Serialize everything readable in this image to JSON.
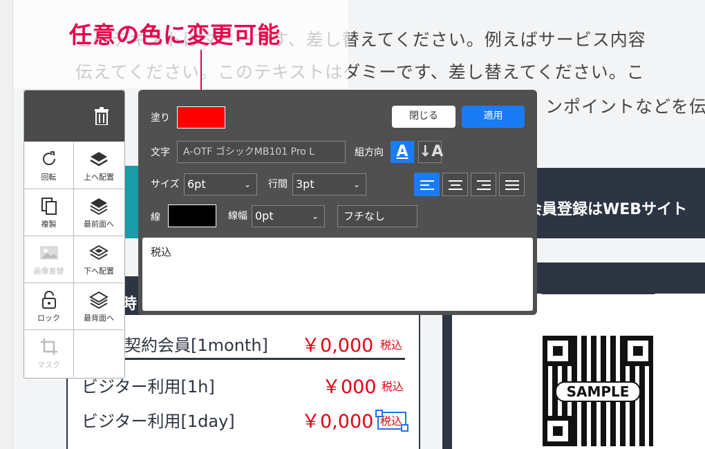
{
  "background": {
    "line1": "このテキストはダミーです、差し替えてください。例えばサービス内容",
    "line2": "伝えてください。このテキストはダミーです、差し替えてください。こ",
    "line3": "ンポイントなどを伝",
    "navy_text": "会員登録はWEBサイト",
    "card_header": "時",
    "prices": [
      {
        "label": "契約会員[1month]",
        "value": "￥0,000",
        "tax": "税込"
      },
      {
        "label": "ビジター利用[1h]",
        "value": "￥000",
        "tax": "税込"
      },
      {
        "label": "ビジター利用[1day]",
        "value": "￥0,000",
        "tax": "税込"
      }
    ],
    "qr_label": "SAMPLE"
  },
  "annotation": "任意の色に変更可能",
  "toolbox": {
    "delete_icon": "trash-icon",
    "tools": [
      {
        "label": "回転",
        "icon": "rotate-icon"
      },
      {
        "label": "上へ配置",
        "icon": "layer-up-icon"
      },
      {
        "label": "複製",
        "icon": "duplicate-icon"
      },
      {
        "label": "最前面へ",
        "icon": "bring-front-icon"
      },
      {
        "label": "画像差替",
        "icon": "image-icon"
      },
      {
        "label": "下へ配置",
        "icon": "layer-down-icon"
      },
      {
        "label": "ロック",
        "icon": "lock-icon"
      },
      {
        "label": "最背面へ",
        "icon": "send-back-icon"
      },
      {
        "label": "マスク",
        "icon": "crop-icon"
      }
    ]
  },
  "editor": {
    "fill_label": "塗り",
    "fill_color": "#ff0000",
    "close_label": "閉じる",
    "apply_label": "適用",
    "font_label": "文字",
    "font_value": "A-OTF ゴシックMB101 Pro L",
    "direction_label": "組方向",
    "size_label": "サイズ",
    "size_value": "6pt",
    "leading_label": "行間",
    "leading_value": "3pt",
    "stroke_label": "線",
    "stroke_color": "#000000",
    "stroke_width_label": "線幅",
    "stroke_width_value": "0pt",
    "border_style_value": "フチなし",
    "text_value": "税込"
  }
}
